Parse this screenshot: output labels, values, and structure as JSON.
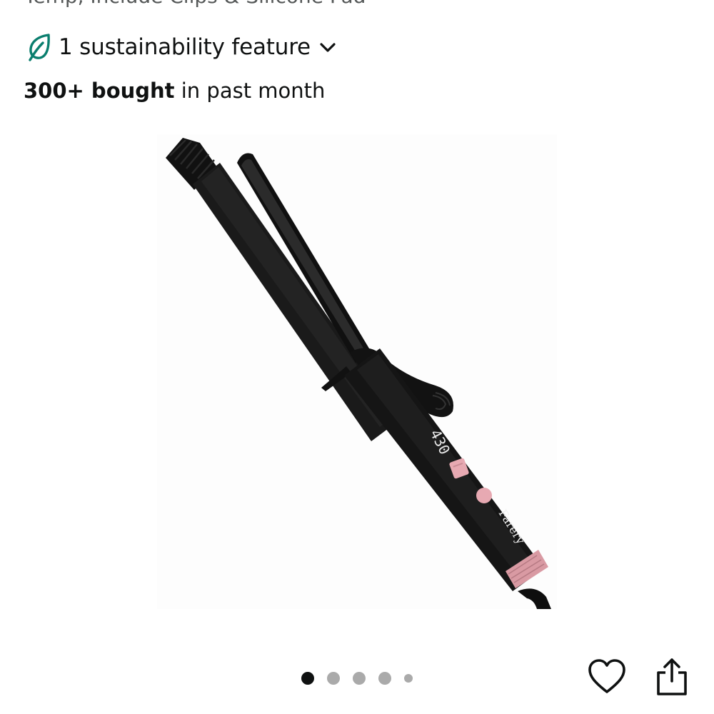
{
  "product": {
    "title_partial": "Temp, Include Clips & Silicone Pad"
  },
  "sustainability": {
    "label": "1 sustainability feature",
    "icon": "leaf-icon",
    "expand_icon": "chevron-down-icon",
    "color": "#0a7e6e"
  },
  "social_proof": {
    "count": "300+ bought",
    "suffix": " in past month"
  },
  "image": {
    "display_temp": "430",
    "brand": "Farery",
    "description": "black curling iron with rose-gold buttons and ring"
  },
  "carousel": {
    "total_dots": 5,
    "active_index": 0
  },
  "actions": {
    "favorite_icon": "heart-icon",
    "share_icon": "share-icon"
  },
  "colors": {
    "accent_rose": "#e7a9b2",
    "barrel": "#141414",
    "dot_active": "#0f1111",
    "dot_inactive": "#aaaaaa"
  }
}
